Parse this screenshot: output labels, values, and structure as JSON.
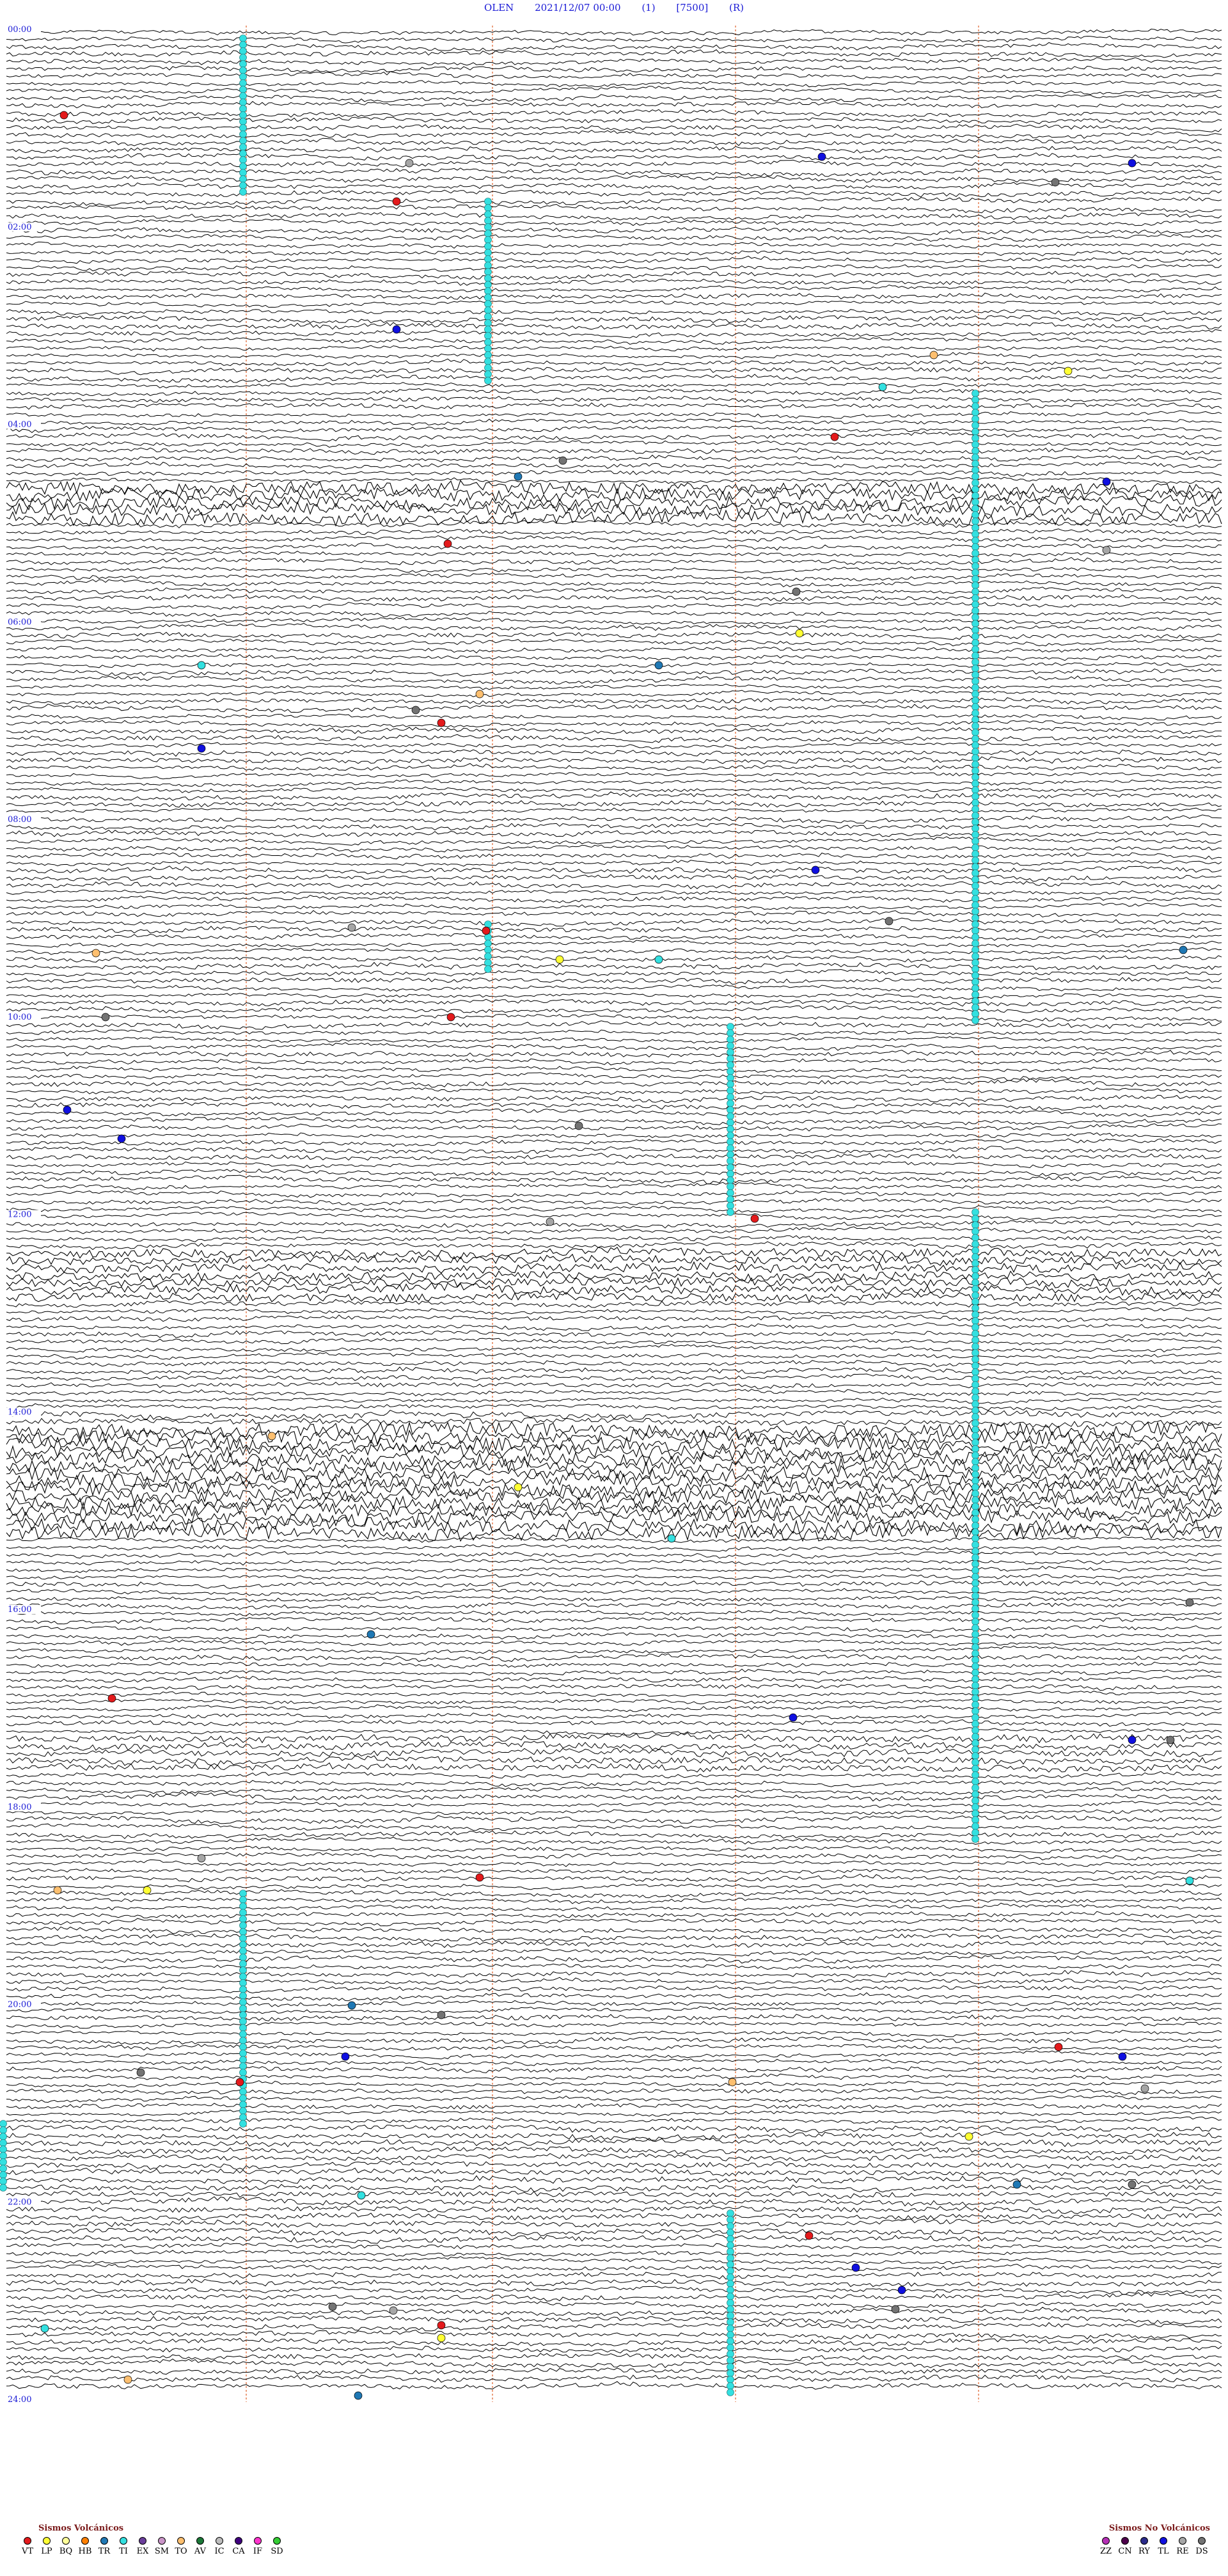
{
  "header": {
    "station": "OLEN",
    "datetime": "2021/12/07 00:00",
    "channel": "(1)",
    "gain": "[7500]",
    "mode": "(R)"
  },
  "hour_labels": [
    "00:00",
    "02:00",
    "04:00",
    "06:00",
    "08:00",
    "10:00",
    "12:00",
    "14:00",
    "16:00",
    "18:00",
    "20:00",
    "22:00",
    "24:00"
  ],
  "legend_volcanic": {
    "title": "Sismos Volcánicos",
    "items": [
      {
        "code": "VT",
        "color": "#e31a1c"
      },
      {
        "code": "LP",
        "color": "#ffff33"
      },
      {
        "code": "BQ",
        "color": "#ffff99"
      },
      {
        "code": "HB",
        "color": "#ff7f00"
      },
      {
        "code": "TR",
        "color": "#1f78b4"
      },
      {
        "code": "TI",
        "color": "#33e0e0"
      },
      {
        "code": "EX",
        "color": "#6a3d9a"
      },
      {
        "code": "SM",
        "color": "#c994c7"
      },
      {
        "code": "TO",
        "color": "#fdbf6f"
      },
      {
        "code": "AV",
        "color": "#1b7837"
      },
      {
        "code": "IC",
        "color": "#bdbdbd"
      },
      {
        "code": "CA",
        "color": "#3f007d"
      },
      {
        "code": "IF",
        "color": "#ff33cc"
      },
      {
        "code": "SD",
        "color": "#33cc33"
      }
    ]
  },
  "legend_nonvolcanic": {
    "title": "Sismos No Volcánicos",
    "items": [
      {
        "code": "ZZ",
        "color": "#b52fb5"
      },
      {
        "code": "CN",
        "color": "#4d004b"
      },
      {
        "code": "RY",
        "color": "#2a2a8a"
      },
      {
        "code": "TL",
        "color": "#1010e0"
      },
      {
        "code": "RE",
        "color": "#a6a6a6"
      },
      {
        "code": "DS",
        "color": "#737373"
      }
    ]
  },
  "colors": {
    "trace": "#000000",
    "minute_marker": "#e0602a",
    "label": "#1a1ad6",
    "tremor_fill": "#33e0e0"
  }
}
